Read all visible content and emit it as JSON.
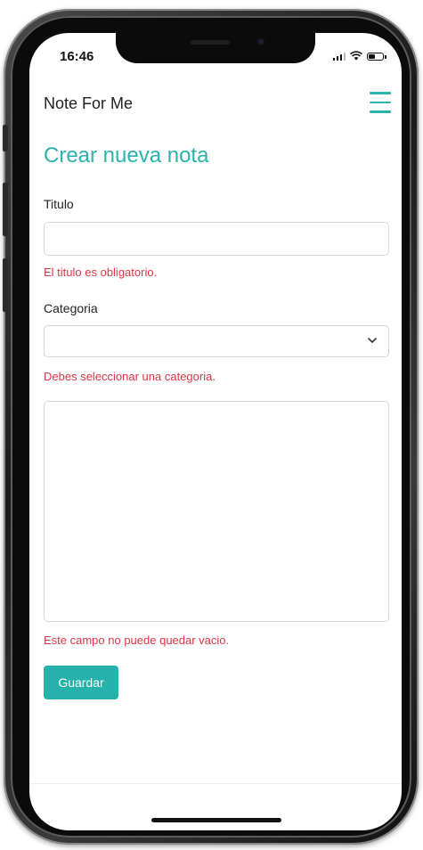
{
  "status_bar": {
    "time": "16:46",
    "battery_level": 0.5
  },
  "navbar": {
    "brand": "Note For Me",
    "menu_icon": "hamburger-menu-icon",
    "accent_color": "#2bb3ac"
  },
  "form": {
    "title": "Crear nueva nota",
    "titulo": {
      "label": "Titulo",
      "value": "",
      "error": "El titulo es obligatorio."
    },
    "categoria": {
      "label": "Categoria",
      "selected": "",
      "icon": "chevron-down-icon",
      "error": "Debes seleccionar una categoria."
    },
    "contenido": {
      "value": "",
      "error": "Este campo no puede quedar vacio."
    },
    "save_label": "Guardar",
    "error_color": "#dc3545"
  }
}
